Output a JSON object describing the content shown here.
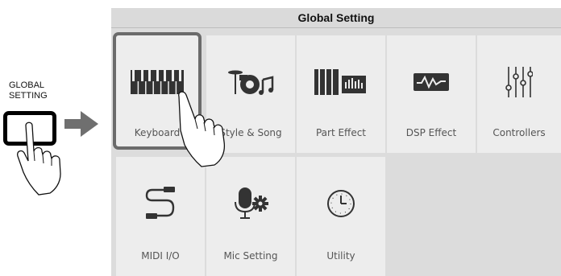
{
  "instruction": {
    "button_label_line1": "GLOBAL",
    "button_label_line2": "SETTING"
  },
  "window": {
    "title": "Global Setting"
  },
  "tiles": [
    {
      "label": "Keyboard",
      "icon": "keyboard-icon",
      "selected": true
    },
    {
      "label": "Style & Song",
      "icon": "drum-kit-icon",
      "selected": false
    },
    {
      "label": "Part Effect",
      "icon": "part-effect-icon",
      "selected": false
    },
    {
      "label": "DSP Effect",
      "icon": "dsp-waveform-icon",
      "selected": false
    },
    {
      "label": "Controllers",
      "icon": "sliders-icon",
      "selected": false
    },
    {
      "label": "MIDI I/O",
      "icon": "midi-cable-icon",
      "selected": false
    },
    {
      "label": "Mic Setting",
      "icon": "microphone-gear-icon",
      "selected": false
    },
    {
      "label": "Utility",
      "icon": "clock-icon",
      "selected": false
    }
  ],
  "colors": {
    "panel_bg": "#dcdcdc",
    "tile_bg": "#ededed",
    "icon": "#333333",
    "selected_border": "#6b6b6b"
  }
}
